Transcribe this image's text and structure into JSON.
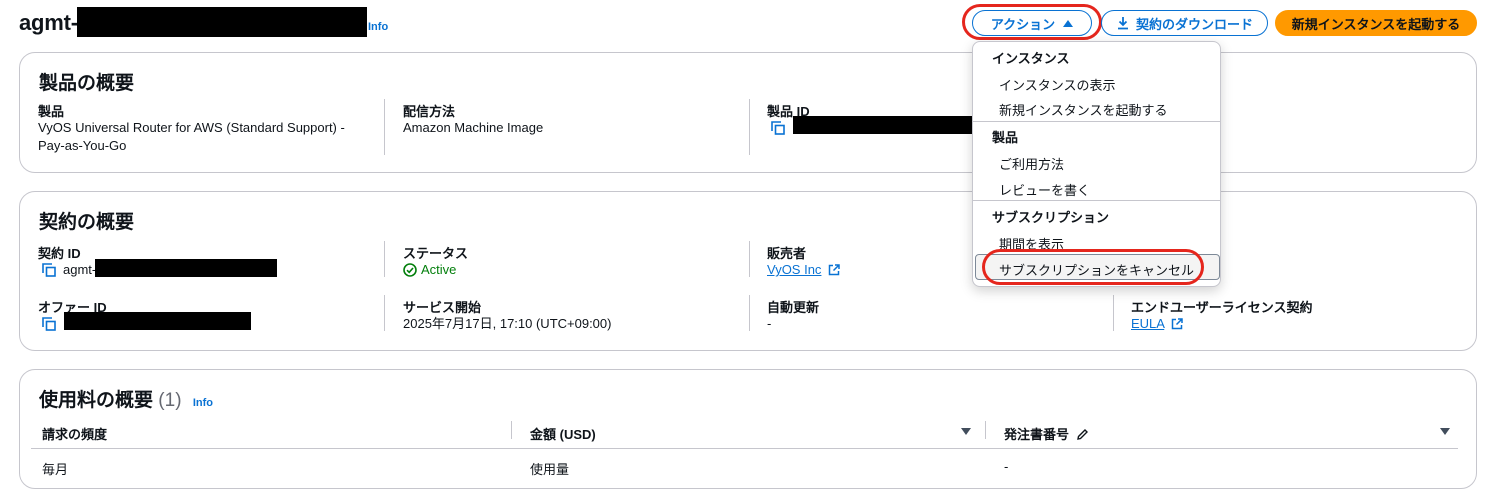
{
  "header": {
    "title_prefix": "agmt-",
    "info": "Info",
    "actions_label": "アクション",
    "download_label": "契約のダウンロード",
    "launch_label": "新規インスタンスを起動する"
  },
  "product_overview": {
    "title": "製品の概要",
    "product_label": "製品",
    "product_value_1": "VyOS Universal Router for AWS (Standard Support) -",
    "product_value_2": "Pay-as-You-Go",
    "delivery_label": "配信方法",
    "delivery_value": "Amazon Machine Image",
    "product_id_label": "製品 ID"
  },
  "agreement_overview": {
    "title": "契約の概要",
    "agreement_id_label": "契約 ID",
    "agreement_id_prefix": "agmt-",
    "status_label": "ステータス",
    "status_value": "Active",
    "seller_label": "販売者",
    "seller_value": "VyOS Inc",
    "offer_id_label": "オファー ID",
    "service_start_label": "サービス開始",
    "service_start_value": "2025年7月17日, 17:10 (UTC+09:00)",
    "auto_renew_label": "自動更新",
    "auto_renew_value": "-",
    "eula_label": "エンドユーザーライセンス契約",
    "eula_value": "EULA"
  },
  "usage_overview": {
    "title": "使用料の概要",
    "count": "(1)",
    "info": "Info",
    "columns": [
      "請求の頻度",
      "金額 (USD)",
      "発注書番号"
    ],
    "rows": [
      [
        "毎月",
        "使用量",
        "-"
      ]
    ]
  },
  "actions_menu": {
    "group_instances": "インスタンス",
    "item_view_instances": "インスタンスの表示",
    "item_launch_instance": "新規インスタンスを起動する",
    "group_product": "製品",
    "item_usage": "ご利用方法",
    "item_review": "レビューを書く",
    "group_subscription": "サブスクリプション",
    "item_view_period": "期間を表示",
    "item_cancel": "サブスクリプションをキャンセル"
  },
  "colors": {
    "accent": "#0972d3",
    "primary_button": "#ff9900",
    "status_active": "#037f0c",
    "highlight": "#e5261d"
  }
}
